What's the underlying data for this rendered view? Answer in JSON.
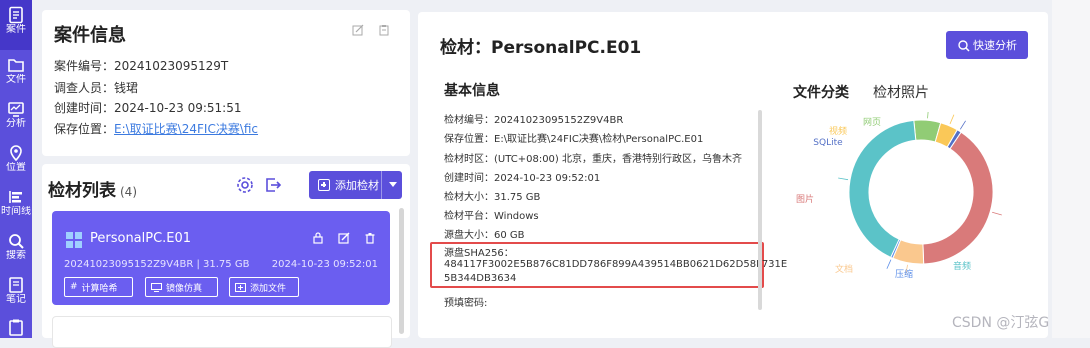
{
  "nav": {
    "items": [
      {
        "label": "案件",
        "icon": "document-icon",
        "active": true
      },
      {
        "label": "文件",
        "icon": "folder-icon"
      },
      {
        "label": "分析",
        "icon": "monitor-icon"
      },
      {
        "label": "位置",
        "icon": "location-icon"
      },
      {
        "label": "时间线",
        "icon": "timeline-icon"
      },
      {
        "label": "搜索",
        "icon": "search-icon"
      },
      {
        "label": "笔记",
        "icon": "note-icon"
      },
      {
        "label": "",
        "icon": "clipboard-icon"
      }
    ]
  },
  "case": {
    "title": "案件信息",
    "number_label": "案件编号：",
    "number": "20241023095129T",
    "investigator_label": "调查人员：",
    "investigator": "钱珺",
    "created_label": "创建时间：",
    "created": "2024-10-23 09:51:51",
    "location_label": "保存位置：",
    "location": "E:\\取证比赛\\24FIC决赛\\fic"
  },
  "evidence_list": {
    "title": "检材列表",
    "count": "(4)",
    "add_label": "添加检材",
    "items": [
      {
        "name": "PersonalPC.E01",
        "meta": "20241023095152Z9V4BR | 31.75 GB",
        "date": "2024-10-23 09:52:01",
        "btn_hash": "计算哈希",
        "btn_image": "镜像仿真",
        "btn_addfile": "添加文件"
      }
    ]
  },
  "detail": {
    "title": "检材：PersonalPC.E01",
    "quick_label": "快速分析",
    "basic_title": "基本信息",
    "props": [
      {
        "k": "检材编号：",
        "v": "20241023095152Z9V4BR"
      },
      {
        "k": "保存位置：",
        "v": "E:\\取证比赛\\24FIC决赛\\检材\\PersonalPC.E01"
      },
      {
        "k": "检材时区：",
        "v": "(UTC+08:00) 北京，重庆，香港特别行政区，乌鲁木齐"
      },
      {
        "k": "创建时间：",
        "v": "2024-10-23 09:52:01"
      },
      {
        "k": "检材大小：",
        "v": "31.75 GB"
      },
      {
        "k": "检材平台：",
        "v": "Windows"
      },
      {
        "k": "源盘大小：",
        "v": "60 GB"
      }
    ],
    "sha_label": "源盘SHA256：",
    "sha_line1": "484117F3002E5B876C81DD786F899A439514BB0621D62D58F731E",
    "sha_line2": "5B344DB3634",
    "preset_pwd_label": "预填密码:",
    "tabs": [
      "文件分类",
      "检材照片"
    ]
  },
  "chart_data": {
    "type": "pie",
    "style": "donut",
    "categories": [
      "网页",
      "视频",
      "SQLite",
      "图片",
      "文档",
      "压缩",
      "音频"
    ],
    "values": [
      6,
      4,
      1,
      40,
      7,
      0.5,
      41.5
    ],
    "colors": [
      "#91cc75",
      "#fac858",
      "#5470c6",
      "#d97a7a",
      "#fac88e",
      "#5b8ee8",
      "#5bc3c8"
    ]
  },
  "watermark": "CSDN @汀弦G"
}
